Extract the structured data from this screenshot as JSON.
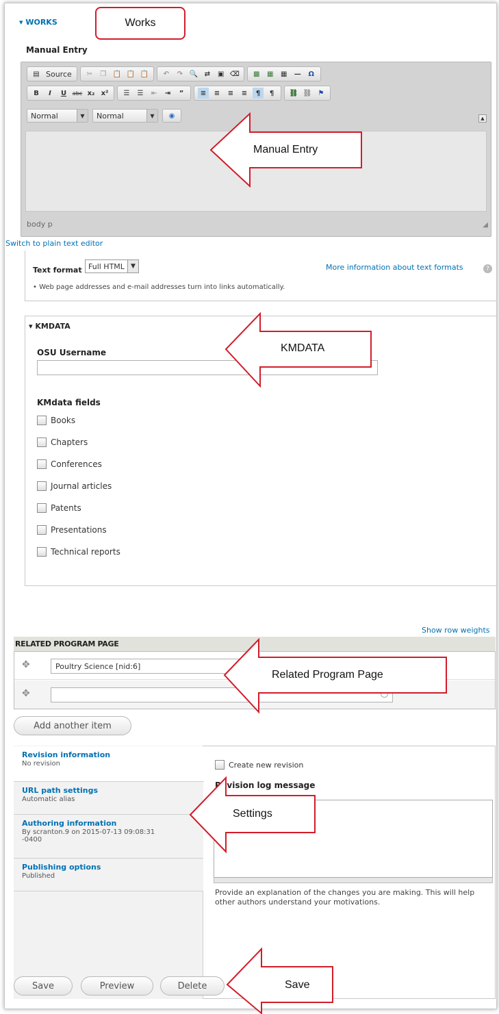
{
  "works": {
    "legend": "▾ WORKS",
    "callout": "Works",
    "manual_entry_label": "Manual Entry"
  },
  "editor": {
    "source_label": "Source",
    "format_combo": "Normal",
    "style_combo": "Normal",
    "status_path": "body  p",
    "callout": "Manual Entry"
  },
  "text_format": {
    "switch_link": "Switch to plain text editor",
    "label": "Text format",
    "value": "Full HTML",
    "more_info_link": "More information about text formats",
    "tip": "Web page addresses and e-mail addresses turn into links automatically."
  },
  "kmdata": {
    "legend": "▾ KMDATA",
    "callout": "KMDATA",
    "username_label": "OSU Username",
    "username_value": "",
    "fields_label": "KMdata fields",
    "fields": [
      "Books",
      "Chapters",
      "Conferences",
      "Journal articles",
      "Patents",
      "Presentations",
      "Technical reports"
    ]
  },
  "related": {
    "show_weights": "Show row weights",
    "header": "RELATED PROGRAM PAGE",
    "rows": [
      "Poultry Science [nid:6]",
      ""
    ],
    "add_another": "Add another item",
    "callout": "Related Program Page"
  },
  "settings": {
    "callout": "Settings",
    "tabs": [
      {
        "title": "Revision information",
        "summary": "No revision"
      },
      {
        "title": "URL path settings",
        "summary": "Automatic alias"
      },
      {
        "title": "Authoring information",
        "summary": "By scranton.9 on 2015-07-13 09:08:31 -0400"
      },
      {
        "title": "Publishing options",
        "summary": "Published"
      }
    ],
    "create_revision": "Create new revision",
    "log_label": "Revision log message",
    "log_help": "Provide an explanation of the changes you are making. This will help other authors understand your motivations."
  },
  "actions": {
    "save": "Save",
    "preview": "Preview",
    "delete": "Delete",
    "callout": "Save"
  },
  "colors": {
    "link": "#0071b3",
    "callout_border": "#d11c2a"
  }
}
